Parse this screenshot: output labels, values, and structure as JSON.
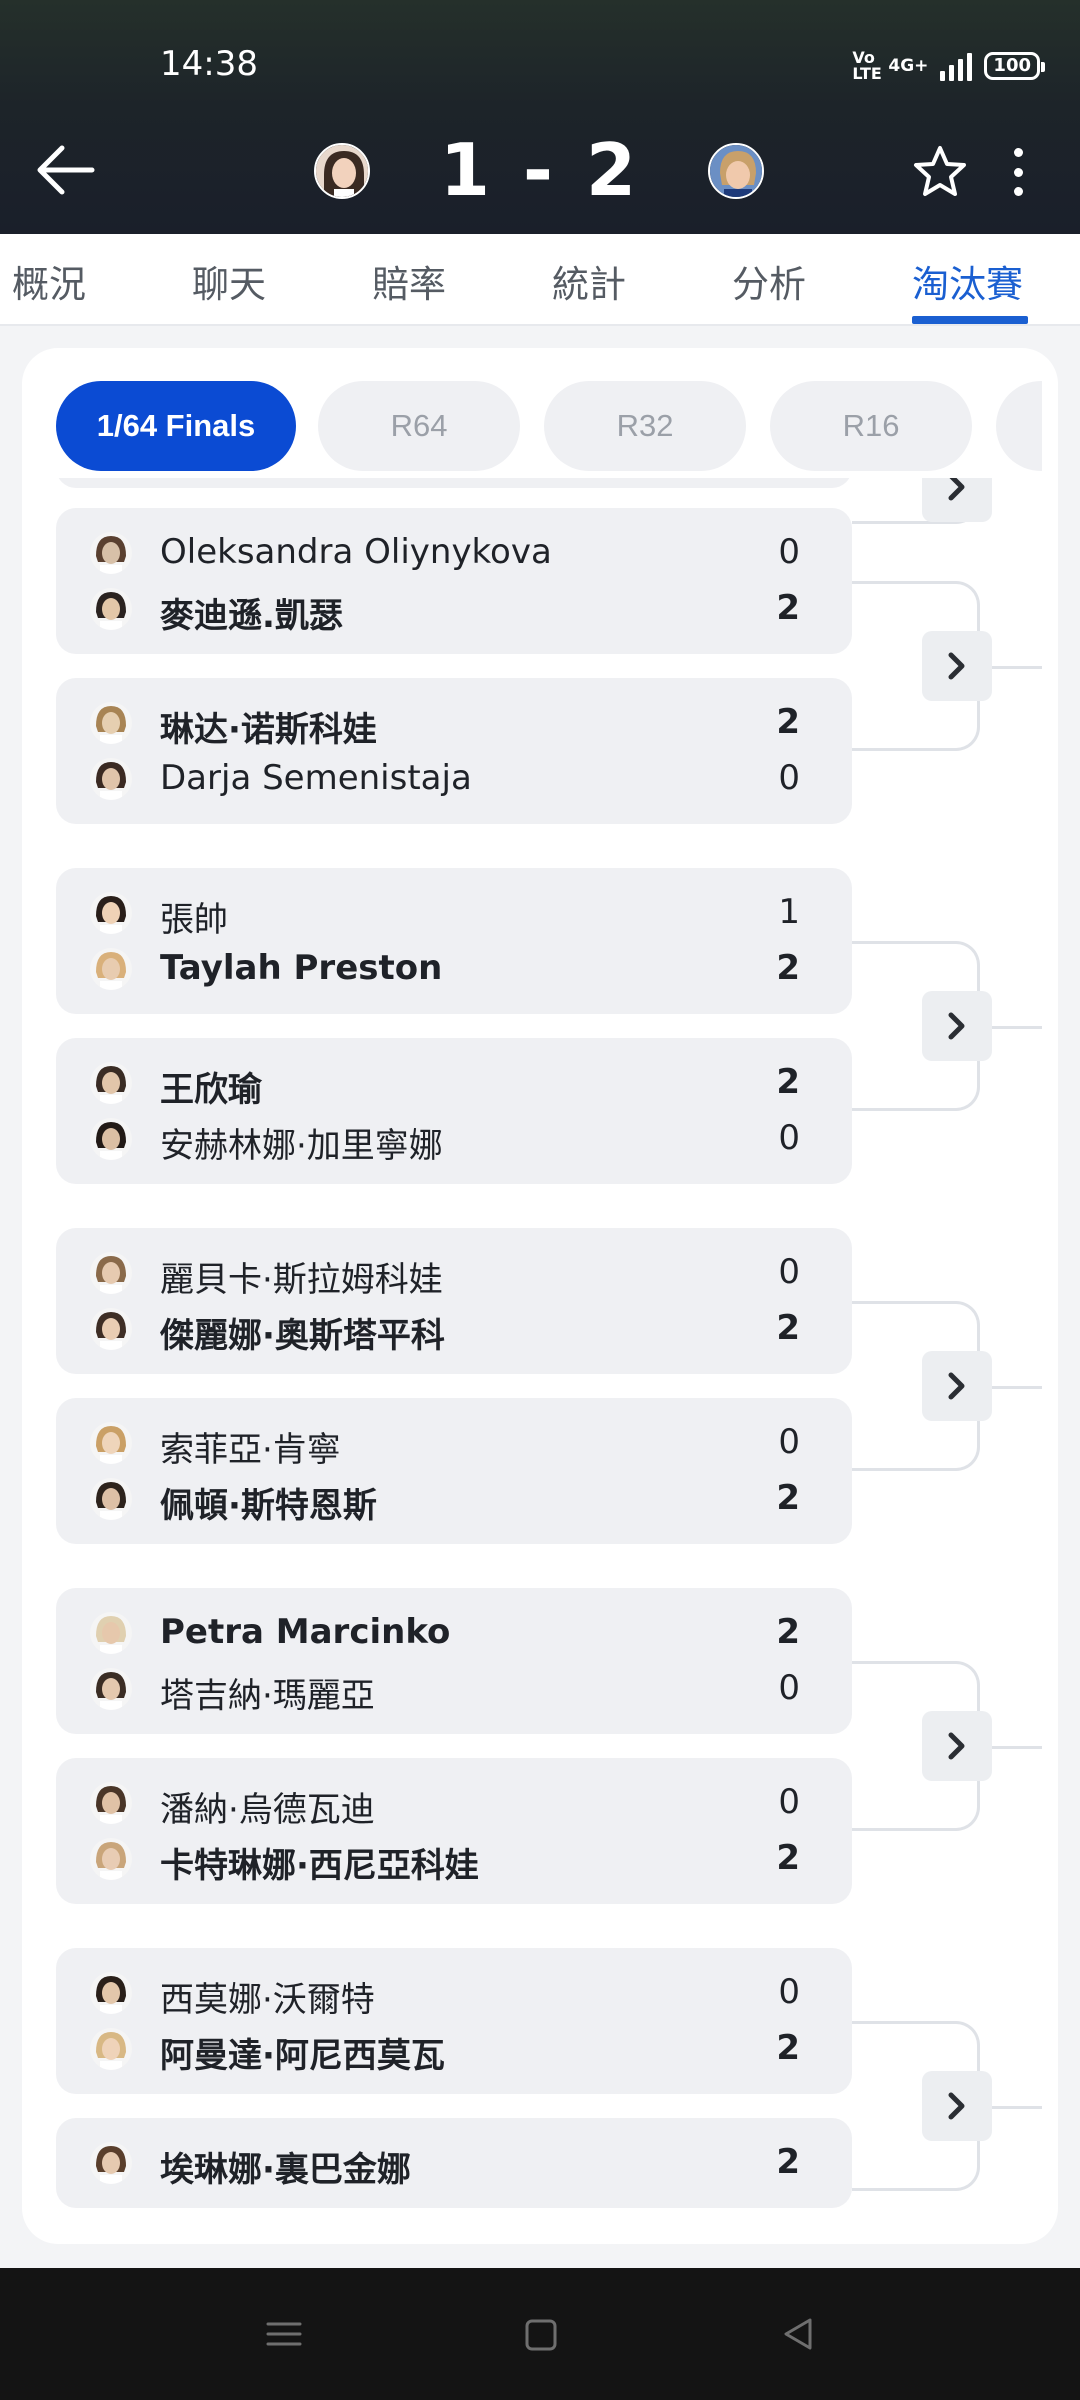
{
  "status_bar": {
    "time": "14:38",
    "volte": "VoLTE",
    "network": "4G+",
    "battery": "100"
  },
  "header": {
    "score": "1 - 2",
    "back_icon": "arrow-left-icon",
    "star_icon": "star-outline-icon",
    "more_icon": "more-vertical-icon"
  },
  "tabs": [
    {
      "label": "概況",
      "active": false
    },
    {
      "label": "聊天",
      "active": false
    },
    {
      "label": "賠率",
      "active": false
    },
    {
      "label": "統計",
      "active": false
    },
    {
      "label": "分析",
      "active": false
    },
    {
      "label": "淘汰賽",
      "active": true
    }
  ],
  "rounds": [
    {
      "label": "1/64 Finals",
      "active": true
    },
    {
      "label": "R64",
      "active": false
    },
    {
      "label": "R32",
      "active": false
    },
    {
      "label": "R16",
      "active": false
    }
  ],
  "matches": [
    {
      "players": [
        {
          "name": "Oleksandra Oliynykova",
          "score": "0",
          "winner": false
        },
        {
          "name": "麥迪遜.凱瑟",
          "score": "2",
          "winner": true
        }
      ]
    },
    {
      "players": [
        {
          "name": "琳达·诺斯科娃",
          "score": "2",
          "winner": true
        },
        {
          "name": "Darja Semenistaja",
          "score": "0",
          "winner": false
        }
      ]
    },
    {
      "players": [
        {
          "name": "張帥",
          "score": "1",
          "winner": false
        },
        {
          "name": "Taylah Preston",
          "score": "2",
          "winner": true
        }
      ]
    },
    {
      "players": [
        {
          "name": "王欣瑜",
          "score": "2",
          "winner": true
        },
        {
          "name": "安赫林娜·加里寧娜",
          "score": "0",
          "winner": false
        }
      ]
    },
    {
      "players": [
        {
          "name": "麗貝卡·斯拉姆科娃",
          "score": "0",
          "winner": false
        },
        {
          "name": "傑麗娜·奧斯塔平科",
          "score": "2",
          "winner": true
        }
      ]
    },
    {
      "players": [
        {
          "name": "索菲亞·肯寧",
          "score": "0",
          "winner": false
        },
        {
          "name": "佩頓·斯特恩斯",
          "score": "2",
          "winner": true
        }
      ]
    },
    {
      "players": [
        {
          "name": "Petra Marcinko",
          "score": "2",
          "winner": true
        },
        {
          "name": "塔吉納·瑪麗亞",
          "score": "0",
          "winner": false
        }
      ]
    },
    {
      "players": [
        {
          "name": "潘納·烏德瓦迪",
          "score": "0",
          "winner": false
        },
        {
          "name": "卡特琳娜·西尼亞科娃",
          "score": "2",
          "winner": true
        }
      ]
    },
    {
      "players": [
        {
          "name": "西莫娜·沃爾特",
          "score": "0",
          "winner": false
        },
        {
          "name": "阿曼達·阿尼西莫瓦",
          "score": "2",
          "winner": true
        }
      ]
    },
    {
      "players": [
        {
          "name": "埃琳娜·裏巴金娜",
          "score": "2",
          "winner": true
        }
      ]
    }
  ],
  "nav": {
    "menu_icon": "menu-icon",
    "home_icon": "home-square-icon",
    "back_icon": "back-triangle-icon"
  },
  "colors": {
    "accent": "#1a5fd1",
    "pill_active": "#0b4bd3",
    "header_bg": "#1d2429"
  }
}
